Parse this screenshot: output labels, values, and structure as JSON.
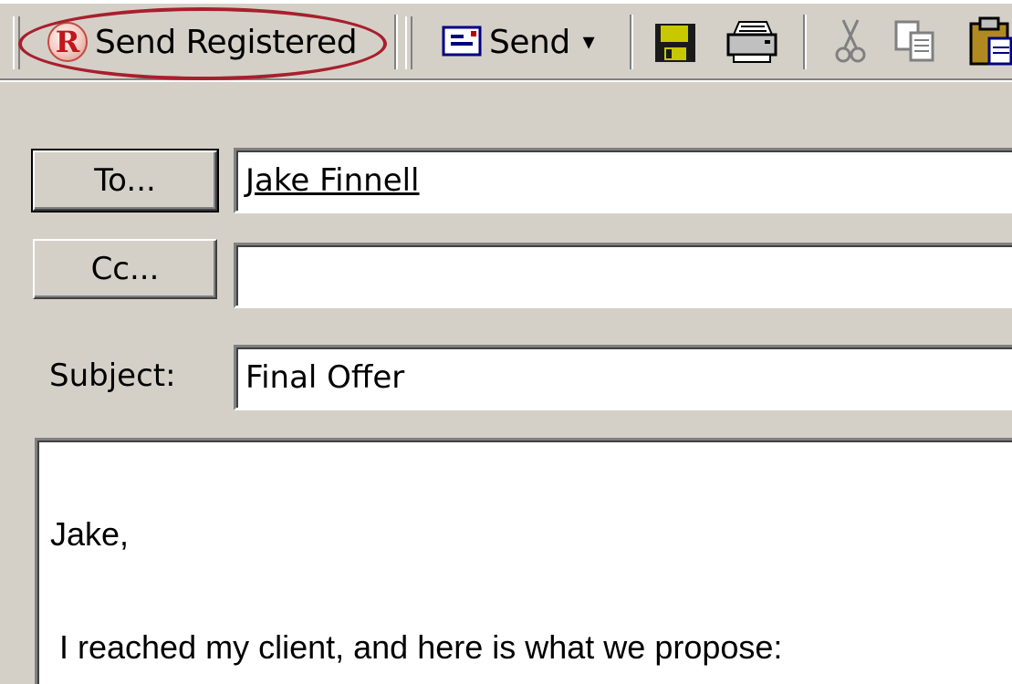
{
  "toolbar": {
    "send_registered_label": "Send Registered",
    "send_registered_icon_glyph": "R",
    "send_label": "Send",
    "send_dropdown_glyph": "▾",
    "icons": [
      "registered-icon",
      "send-envelope-icon",
      "dropdown-arrow-icon",
      "save-icon",
      "print-icon",
      "cut-icon",
      "copy-icon",
      "paste-icon"
    ],
    "highlight_color": "#a81f2d"
  },
  "header": {
    "to_button_label": "To...",
    "cc_button_label": "Cc...",
    "subject_label": "Subject:",
    "to_value": "Jake Finnell",
    "cc_value": "",
    "subject_value": "Final Offer"
  },
  "body": {
    "lines": [
      "Jake,",
      " I reached my client, and here is what we propose:"
    ]
  },
  "colors": {
    "chrome": "#d4d0c8",
    "registered_red": "#c0161c"
  }
}
